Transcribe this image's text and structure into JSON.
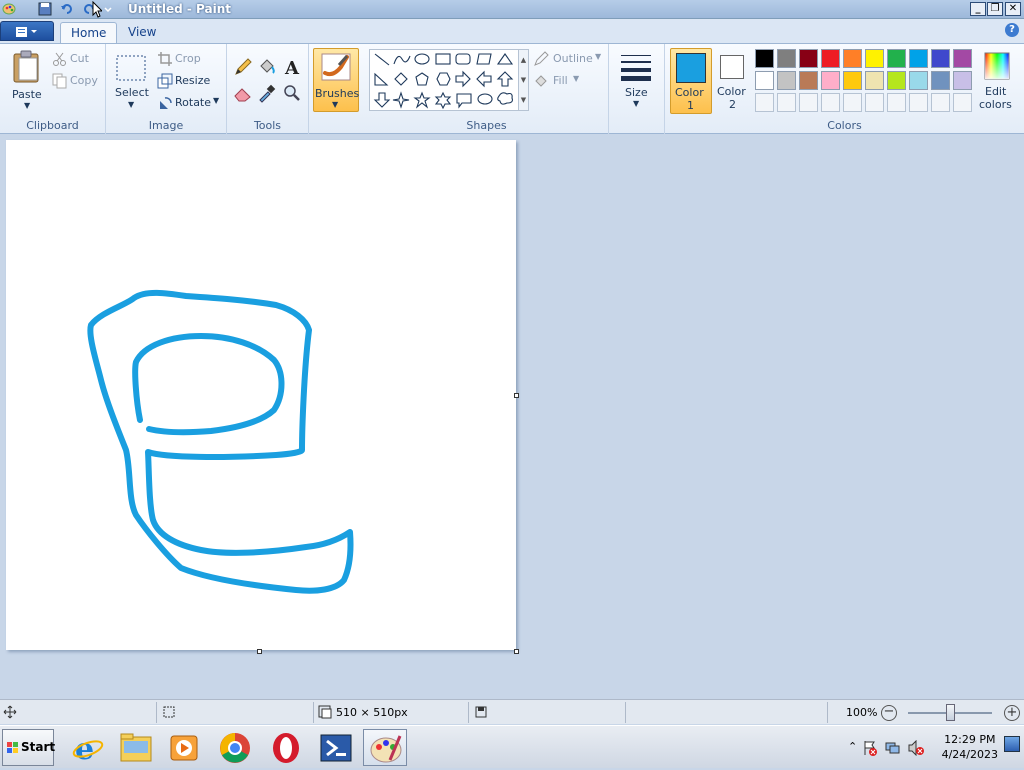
{
  "window": {
    "title": "Untitled - Paint"
  },
  "tabs": [
    {
      "label": "Home"
    },
    {
      "label": "View"
    }
  ],
  "help": "?",
  "clipboard": {
    "paste": "Paste",
    "cut": "Cut",
    "copy": "Copy",
    "group": "Clipboard"
  },
  "image": {
    "select": "Select",
    "crop": "Crop",
    "resize": "Resize",
    "rotate": "Rotate",
    "group": "Image"
  },
  "tools": {
    "group": "Tools"
  },
  "brushes": {
    "label": "Brushes"
  },
  "shapes": {
    "outline": "Outline",
    "fill": "Fill",
    "group": "Shapes"
  },
  "size": {
    "label": "Size"
  },
  "colors": {
    "color1_line1": "Color",
    "color1_line2": "1",
    "color2_line1": "Color",
    "color2_line2": "2",
    "edit_line1": "Edit",
    "edit_line2": "colors",
    "group": "Colors",
    "color1_value": "#1a9fe0",
    "color2_value": "#ffffff",
    "palette_row1": [
      "#000000",
      "#7f7f7f",
      "#880015",
      "#ed1c24",
      "#ff7f27",
      "#fff200",
      "#22b14c",
      "#00a2e8",
      "#3f48cc",
      "#a349a4"
    ],
    "palette_row2": [
      "#ffffff",
      "#c3c3c3",
      "#b97a57",
      "#ffaec9",
      "#ffc90e",
      "#efe4b0",
      "#b5e61d",
      "#99d9ea",
      "#7092be",
      "#c8bfe7"
    ]
  },
  "status": {
    "canvas_size": "510 × 510px",
    "zoom": "100%"
  },
  "taskbar": {
    "start": "Start",
    "time": "12:29 PM",
    "date": "4/24/2023"
  }
}
